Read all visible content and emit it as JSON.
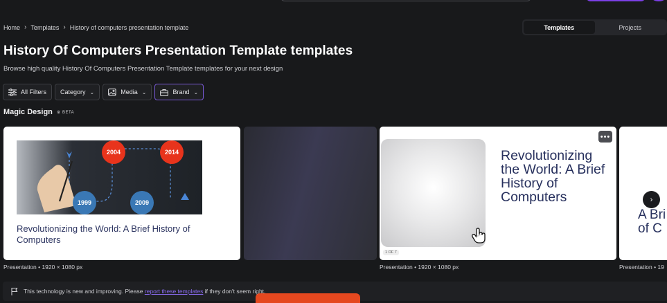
{
  "breadcrumb": [
    "Home",
    "Templates",
    "History of computers presentation template"
  ],
  "toggle": {
    "templates": "Templates",
    "projects": "Projects"
  },
  "page": {
    "title": "History Of Computers Presentation Template templates",
    "subtitle": "Browse high quality History Of Computers Presentation Template templates for your next design"
  },
  "filters": {
    "all": "All Filters",
    "category": "Category",
    "media": "Media",
    "brand": "Brand"
  },
  "magic": {
    "title": "Magic Design",
    "badge": "BETA"
  },
  "cards": {
    "c1": {
      "title": "Revolutionizing the World: A Brief History of Computers",
      "years": [
        "2004",
        "2014",
        "1999",
        "2009"
      ],
      "caption": "Presentation • 1920 × 1080 px"
    },
    "c3": {
      "title": "Revolutionizing the World: A Brief History of Computers",
      "page": "1 OF 7",
      "more": "•••",
      "caption": "Presentation • 1920 × 1080 px"
    },
    "c4": {
      "title": "A Bri\nof C",
      "caption": "Presentation • 19"
    }
  },
  "notice": {
    "pre": "This technology is new and improving. Please",
    "link": "report these templates",
    "post": "if they don't seem right."
  },
  "colors": {
    "accent": "#7b3fe4",
    "background": "#18191b",
    "card_title": "#27305d",
    "year_red": "#e8341c",
    "year_blue": "#3a78b5",
    "orange": "#e5481f"
  }
}
